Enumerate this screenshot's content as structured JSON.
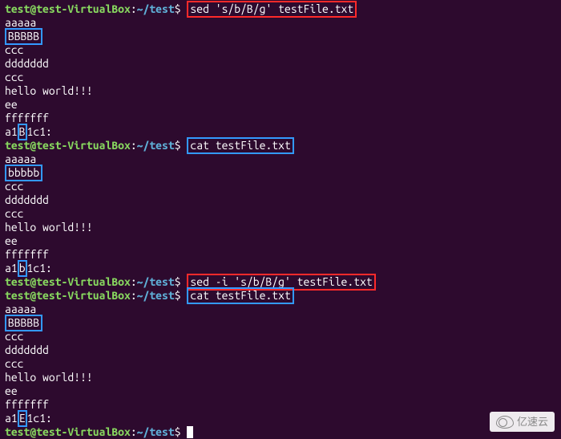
{
  "prompt": {
    "user": "test@test-VirtualBox",
    "sep": ":",
    "path": "~/test",
    "symbol": "$"
  },
  "commands": {
    "sed1": "sed 's/b/B/g' testFile.txt",
    "cat1": "cat testFile.txt",
    "sed2": "sed -i 's/b/B/g' testFile.txt",
    "cat2": "cat testFile.txt"
  },
  "output1": {
    "l1": "aaaaa",
    "l2": "BBBBB",
    "l3": "ccc",
    "l4": "ddddddd",
    "l5": "ccc",
    "l6": "hello world!!!",
    "l7": "ee",
    "l8": "fffffff",
    "l9a": "a1",
    "l9b": "B",
    "l9c": "1c1:"
  },
  "output2": {
    "l1": "aaaaa",
    "l2": "bbbbb",
    "l3": "ccc",
    "l4": "ddddddd",
    "l5": "ccc",
    "l6": "hello world!!!",
    "l7": "ee",
    "l8": "fffffff",
    "l9a": "a1",
    "l9b": "b",
    "l9c": "1c1:"
  },
  "output3": {
    "l1": "aaaaa",
    "l2": "BBBBB",
    "l3": "ccc",
    "l4": "ddddddd",
    "l5": "ccc",
    "l6": "hello world!!!",
    "l7": "ee",
    "l8": "fffffff",
    "l9a": "a1",
    "l9b": "E",
    "l9c": "1c1:"
  },
  "watermark": "亿速云"
}
